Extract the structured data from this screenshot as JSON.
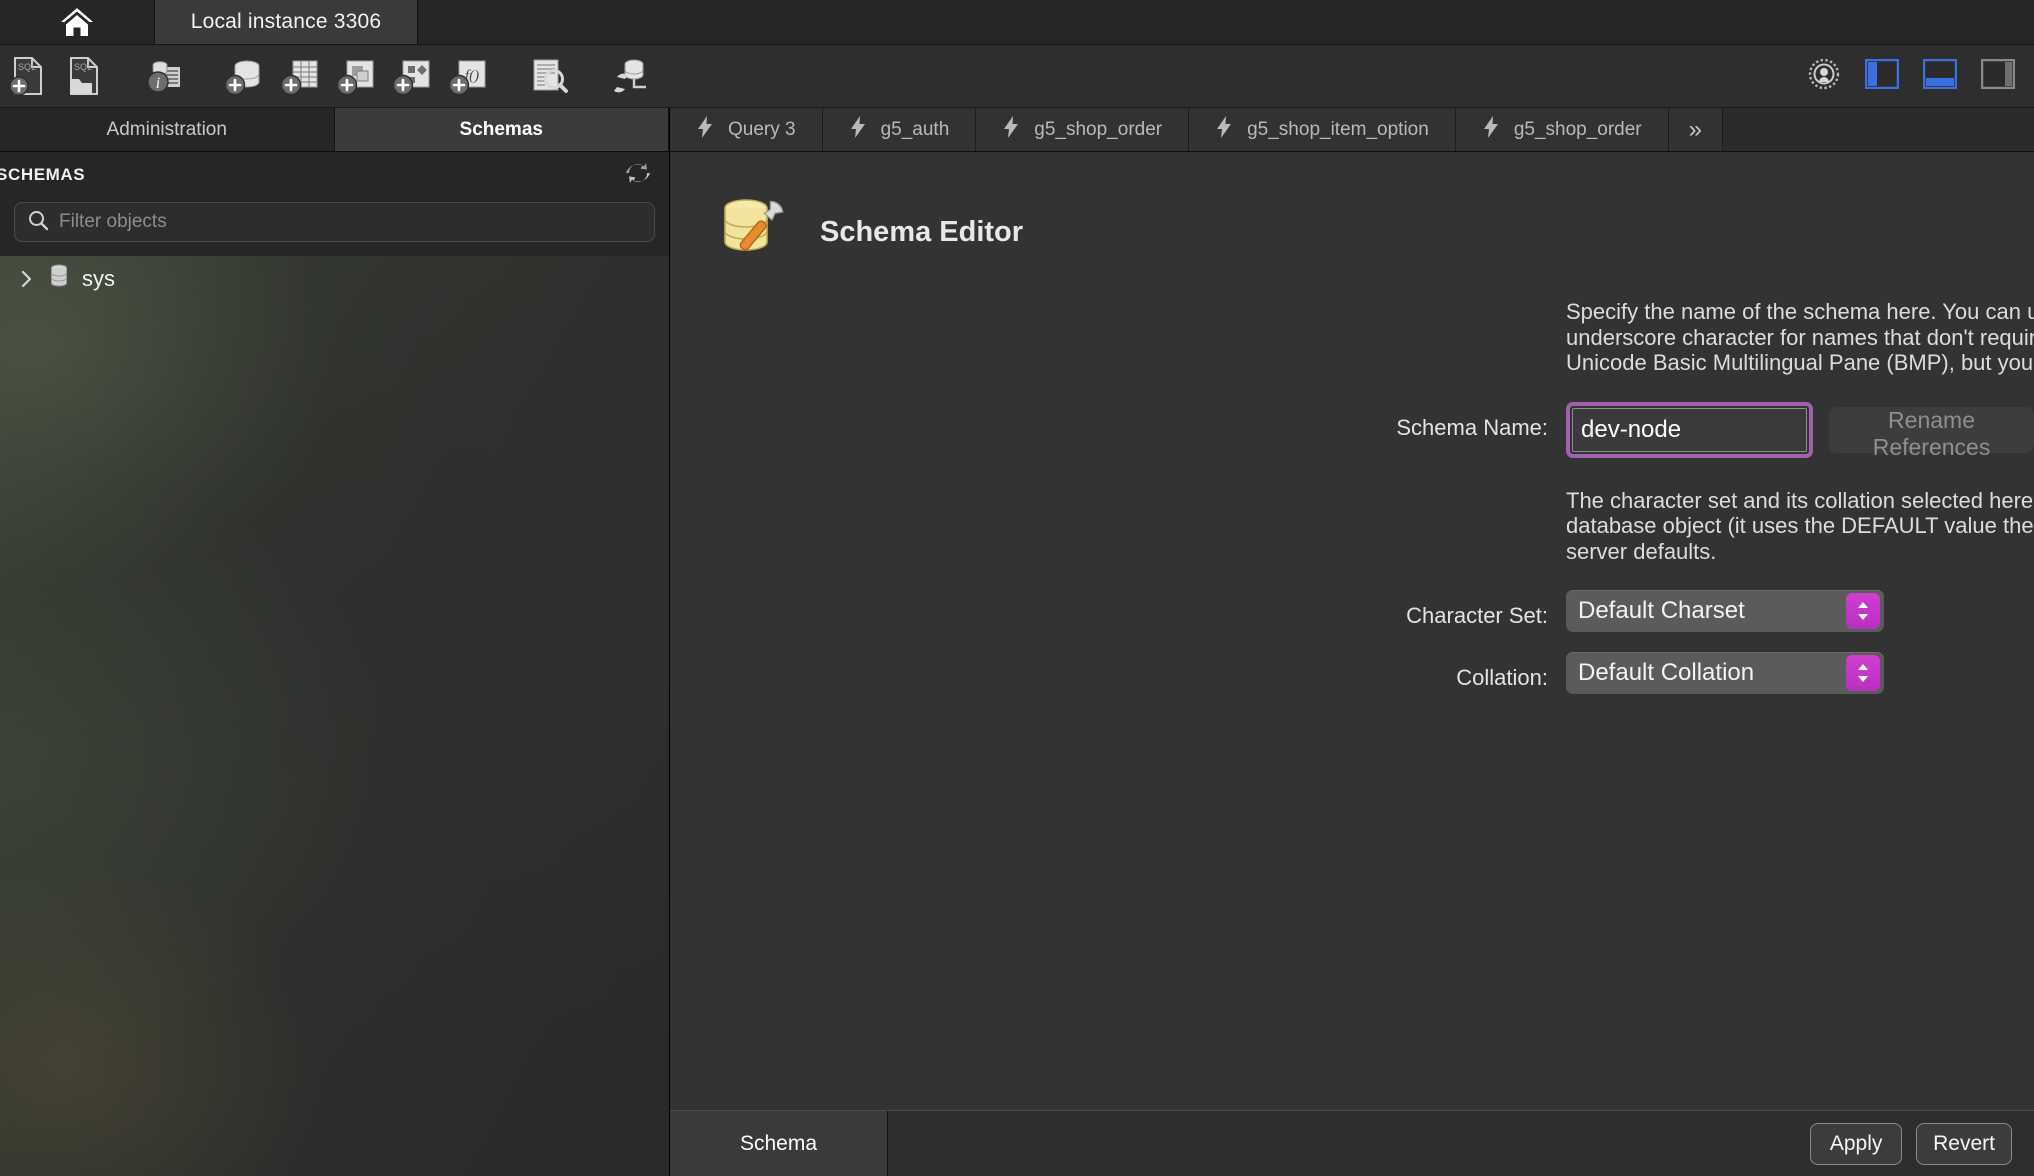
{
  "window": {
    "home_tab_icon": "home-icon",
    "instance_tab_label": "Local instance 3306"
  },
  "toolbar": {
    "buttons": [
      {
        "name": "new-sql-file-button",
        "icon": "new-sql-file-icon"
      },
      {
        "name": "open-sql-file-button",
        "icon": "open-sql-file-icon"
      },
      {
        "name": "connection-info-button",
        "icon": "connection-info-icon"
      },
      {
        "name": "new-schema-button",
        "icon": "new-schema-icon"
      },
      {
        "name": "new-table-button",
        "icon": "new-table-icon"
      },
      {
        "name": "new-view-button",
        "icon": "new-view-icon"
      },
      {
        "name": "new-procedure-button",
        "icon": "new-procedure-icon"
      },
      {
        "name": "new-function-button",
        "icon": "new-function-icon"
      },
      {
        "name": "search-data-button",
        "icon": "search-data-icon"
      },
      {
        "name": "reconnect-server-button",
        "icon": "reconnect-server-icon"
      }
    ],
    "right_buttons": [
      {
        "name": "preferences-button",
        "icon": "gear-icon",
        "state": "off"
      },
      {
        "name": "toggle-sidebar-button",
        "icon": "panel-left-icon",
        "state": "on"
      },
      {
        "name": "toggle-output-button",
        "icon": "panel-bottom-icon",
        "state": "on"
      },
      {
        "name": "toggle-secondary-sidebar-button",
        "icon": "panel-right-icon",
        "state": "off"
      }
    ]
  },
  "sidebar": {
    "tabs": [
      {
        "label": "Administration",
        "active": false
      },
      {
        "label": "Schemas",
        "active": true
      }
    ],
    "section_title": "SCHEMAS",
    "refresh_icon": "refresh-icon",
    "filter": {
      "placeholder": "Filter objects",
      "value": "",
      "icon": "search-icon"
    },
    "tree": [
      {
        "label": "sys",
        "icon": "database-icon",
        "expanded": false,
        "chevron": "chevron-right-icon"
      }
    ]
  },
  "editor_tabs": [
    {
      "label": "Query 3",
      "icon": "lightning-icon"
    },
    {
      "label": "g5_auth",
      "icon": "lightning-icon"
    },
    {
      "label": "g5_shop_order",
      "icon": "lightning-icon"
    },
    {
      "label": "g5_shop_item_option",
      "icon": "lightning-icon"
    },
    {
      "label": "g5_shop_order",
      "icon": "lightning-icon"
    }
  ],
  "editor_tabs_overflow": "»",
  "schema_editor": {
    "icon": "schema-editor-icon",
    "title": "Schema Editor",
    "description_name": [
      "Specify the name of the schema here. You can use any combination of ANSI le",
      "underscore character for names that don't require quoting. For more flexibility",
      "Unicode Basic Multilingual Pane (BMP), but you will have to quote the name la"
    ],
    "name_label": "Schema Name:",
    "name_value": "dev-node",
    "rename_button_label": "Rename References",
    "description_charset": [
      "The character set and its collation selected here will be used when no other cl",
      "database object (it uses the DEFAULT value then). Setting DEFAULT here will r",
      "server defaults."
    ],
    "charset_label": "Character Set:",
    "charset_value": "Default Charset",
    "collation_label": "Collation:",
    "collation_value": "Default Collation"
  },
  "bottom_bar": {
    "tab_label": "Schema",
    "apply_label": "Apply",
    "revert_label": "Revert"
  },
  "colors": {
    "accent_purple": "#a061ac",
    "accent_magenta": "#cf3fd0",
    "panel_blue": "#3c6fe0",
    "bg_dark": "#2b2b2b",
    "editor_bg": "#333333"
  }
}
